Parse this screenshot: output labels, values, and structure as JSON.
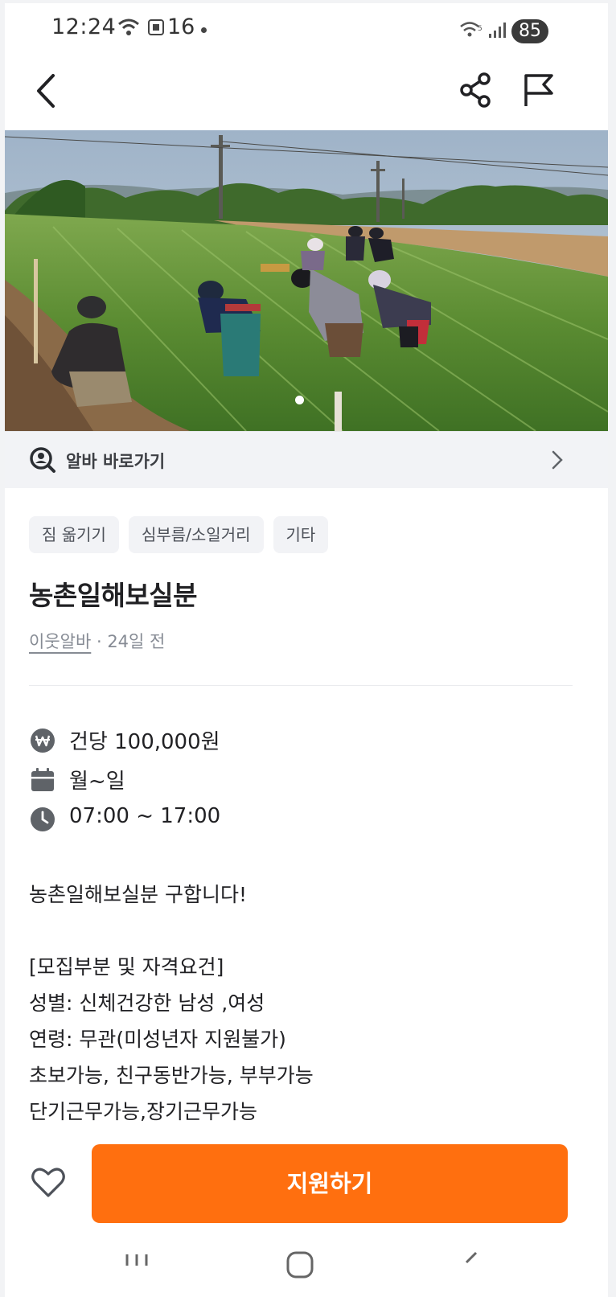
{
  "status_bar": {
    "time": "12:24",
    "notif_count": "16",
    "battery": "85"
  },
  "nav": {
    "back_icon": "chevron-left-icon",
    "share_icon": "share-icon",
    "report_icon": "flag-icon"
  },
  "photo": {
    "description_icon": "farm-field-photo",
    "page_indicator_count": 1
  },
  "shortcut": {
    "icon": "search-person-icon",
    "label": "알바 바로가기"
  },
  "tags": [
    "짐 옮기기",
    "심부름/소일거리",
    "기타"
  ],
  "post": {
    "title": "농촌일해보실분",
    "author": "이웃알바",
    "separator": " · ",
    "time_ago": "24일 전"
  },
  "info": {
    "pay": "건당 100,000원",
    "days": "월~일",
    "hours": "07:00 ~ 17:00"
  },
  "description": {
    "line1": "농촌일해보실분 구합니다!",
    "line2": "[모집부분 및 자격요건]",
    "line3": "성별: 신체건강한 남성 ,여성",
    "line4": "연령: 무관(미성년자 지원불가)",
    "line5": "초보가능, 친구동반가능, 부부가능",
    "line6": "단기근무가능,장기근무가능"
  },
  "bottom": {
    "like_icon": "heart-icon",
    "apply_label": "지원하기"
  },
  "colors": {
    "accent": "#ff6f0f",
    "text": "#212124",
    "subtext": "#868b94",
    "tag_bg": "#f2f3f6"
  }
}
